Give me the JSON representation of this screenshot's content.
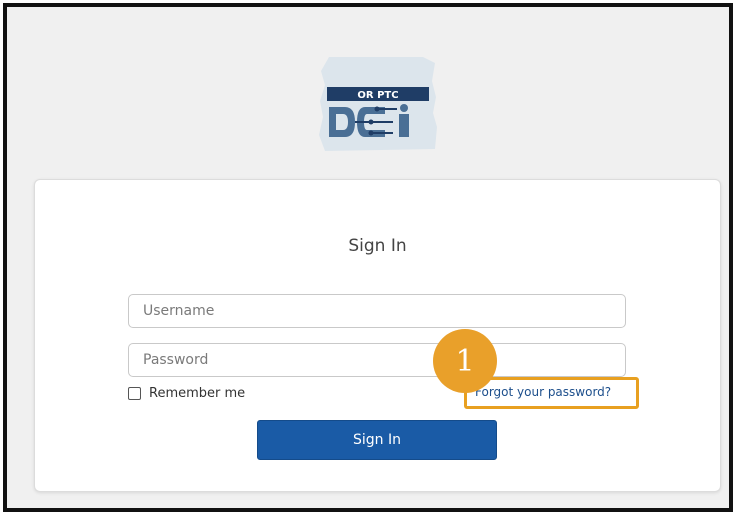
{
  "logo": {
    "tagline": "OR PTC",
    "wordmark": "DCI",
    "icon": "oregon-state-logo-icon"
  },
  "signin_form": {
    "title": "Sign In",
    "username_placeholder": "Username",
    "password_placeholder": "Password",
    "remember_label": "Remember me",
    "remember_checked": false,
    "forgot_link": "Forgot your password?",
    "submit_label": "Sign In"
  },
  "annotation": {
    "step_number": "1",
    "highlight_color": "#e8a020"
  },
  "colors": {
    "primary_button": "#1a5ba6",
    "link": "#1d4f8c",
    "page_background": "#f0f0f0"
  }
}
